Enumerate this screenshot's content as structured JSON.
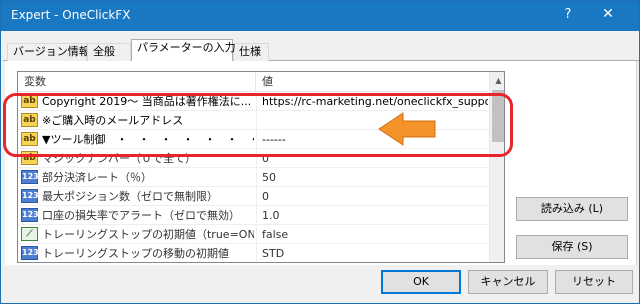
{
  "window": {
    "title": "Expert - OneClickFX",
    "help": "?",
    "close": "✕"
  },
  "tabs": [
    {
      "label": "バージョン情報"
    },
    {
      "label": "全般"
    },
    {
      "label": "パラメーターの入力"
    },
    {
      "label": "仕様"
    }
  ],
  "grid": {
    "headers": {
      "name": "変数",
      "value": "値"
    },
    "rows": [
      {
        "icon": "ab",
        "name": "Copyright 2019～ 当商品は著作権法に...",
        "value": "https://rc-marketing.net/oneclickfx_suppo..."
      },
      {
        "icon": "ab",
        "name": "※ご購入時のメールアドレス",
        "value": ""
      },
      {
        "icon": "ab",
        "name": "▼ツール制御　・　・　・　・　・　・　・",
        "value": "------"
      },
      {
        "icon": "ab",
        "name": "マジックナンバー（０で全て）",
        "value": "0"
      },
      {
        "icon": "123",
        "name": "部分決済レート（％）",
        "value": "50"
      },
      {
        "icon": "123",
        "name": "最大ポジション数（ゼロで無制限）",
        "value": "0"
      },
      {
        "icon": "123",
        "name": "口座の損失率でアラート（ゼロで無効）",
        "value": "1.0"
      },
      {
        "icon": "bool",
        "name": "トレーリングストップの初期値（true=ON）",
        "value": "false"
      },
      {
        "icon": "123",
        "name": "トレーリングストップの移動の初期値",
        "value": "STD"
      }
    ]
  },
  "buttons": {
    "load": "読み込み (L)",
    "save": "保存 (S)",
    "ok": "OK",
    "cancel": "キャンセル",
    "reset": "リセット"
  },
  "colors": {
    "titlebar": "#1a78c2",
    "highlight": "#e8252a",
    "arrow": "#f5922a"
  }
}
